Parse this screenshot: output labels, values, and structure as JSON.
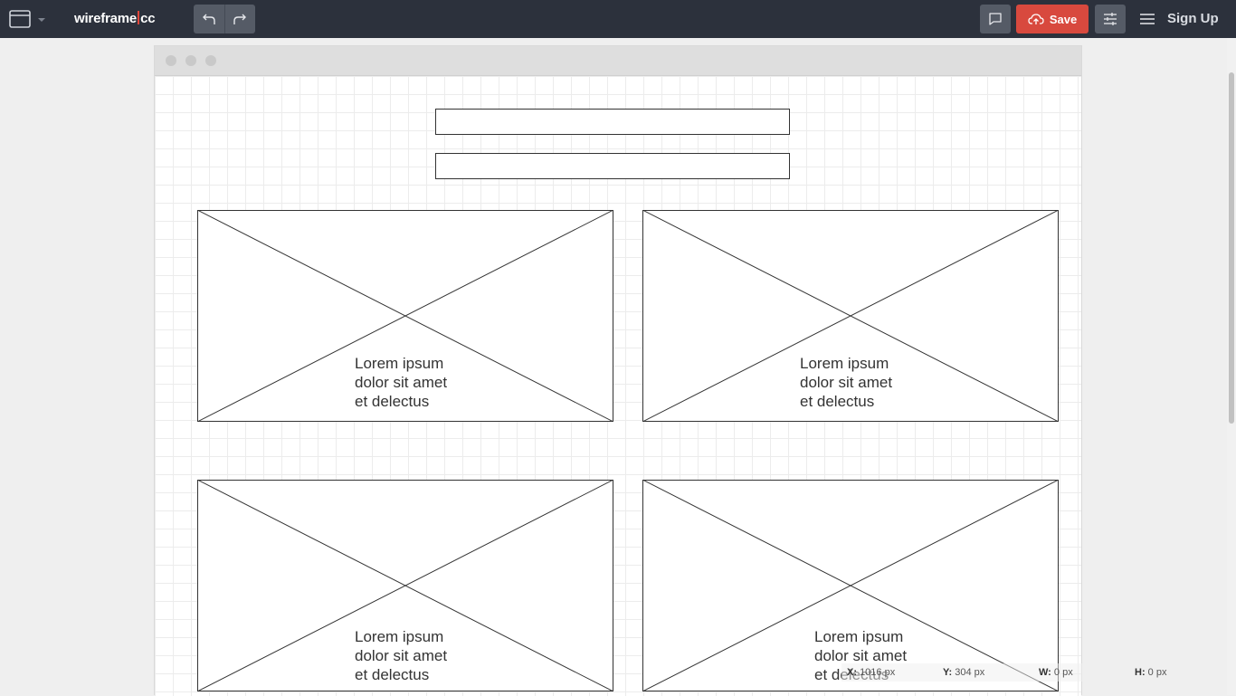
{
  "header": {
    "logo_left": "wireframe",
    "logo_right": "cc",
    "save_label": "Save",
    "signup_label": "Sign Up",
    "icons": {
      "app": "browser-window-icon",
      "caret": "caret-down-icon",
      "undo": "undo-icon",
      "redo": "redo-icon",
      "comment": "comment-icon",
      "save": "cloud-upload-icon",
      "settings": "sliders-icon",
      "menu": "hamburger-menu-icon"
    },
    "colors": {
      "bar": "#2c313c",
      "save": "#d8493e",
      "logo_accent": "#e0453a"
    }
  },
  "canvas": {
    "placeholders": [
      {
        "caption": [
          "Lorem ipsum",
          "dolor sit amet",
          "et delectus"
        ]
      },
      {
        "caption": [
          "Lorem ipsum",
          "dolor sit amet",
          "et delectus"
        ]
      },
      {
        "caption": [
          "Lorem ipsum",
          "dolor sit amet",
          "et delectus"
        ]
      },
      {
        "caption": [
          "Lorem ipsum",
          "dolor sit amet",
          "et delectus"
        ]
      }
    ]
  },
  "status": {
    "x_label": "X:",
    "x_value": "1016 px",
    "y_label": "Y:",
    "y_value": "304 px",
    "w_label": "W:",
    "w_value": "0 px",
    "h_label": "H:",
    "h_value": "0 px"
  }
}
